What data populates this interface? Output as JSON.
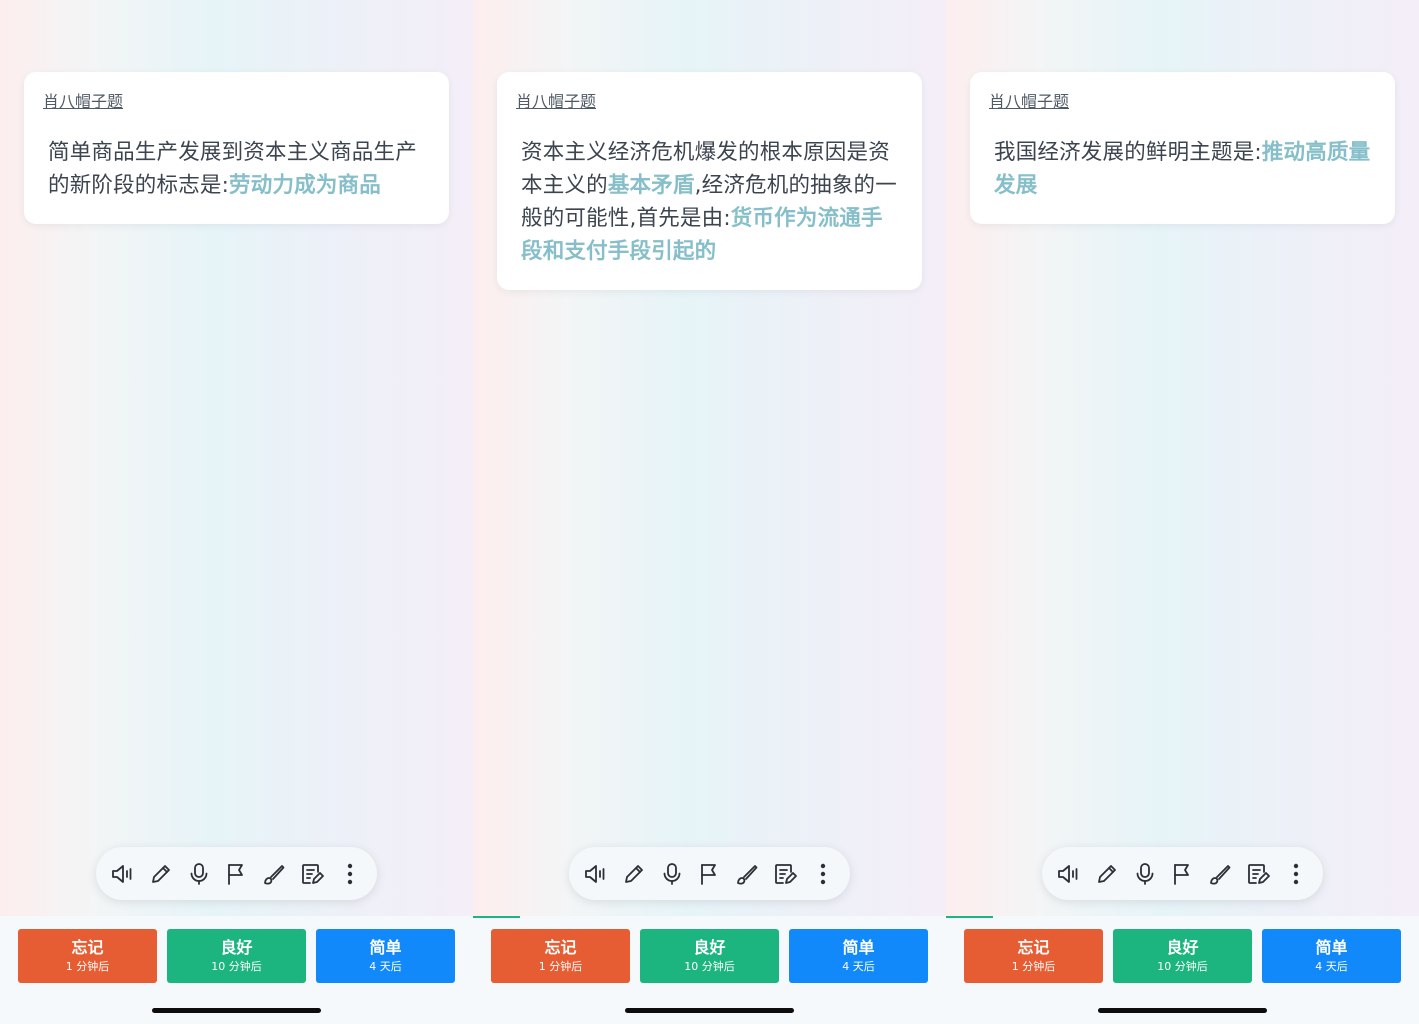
{
  "screens": [
    {
      "tag": "肖八帽子题",
      "question": {
        "prefix": "简单商品生产发展到资本主义商品生产的新阶段的标志是:",
        "answer1": "劳动力成为商品",
        "mid": "",
        "answer2": "",
        "suffix": ""
      }
    },
    {
      "tag": "肖八帽子题",
      "question": {
        "prefix": "资本主义经济危机爆发的根本原因是资本主义的",
        "answer1": "基本矛盾",
        "mid": ",经济危机的抽象的一般的可能性,首先是由:",
        "answer2": "货币作为流通手段和支付手段引起的",
        "suffix": ""
      }
    },
    {
      "tag": "肖八帽子题",
      "question": {
        "prefix": "我国经济发展的鲜明主题是:",
        "answer1": "推动高质量发展",
        "mid": "",
        "answer2": "",
        "suffix": ""
      }
    }
  ],
  "progress_fraction": [
    0,
    0.1,
    0.1
  ],
  "toolbar": {
    "icons": [
      "speaker-icon",
      "pencil-icon",
      "microphone-icon",
      "flag-icon",
      "brush-icon",
      "note-edit-icon",
      "more-vertical-icon"
    ]
  },
  "buttons": {
    "forget": {
      "label": "忘记",
      "sub": "1 分钟后"
    },
    "good": {
      "label": "良好",
      "sub": "10 分钟后"
    },
    "easy": {
      "label": "简单",
      "sub": "4 天后"
    }
  },
  "colors": {
    "answer": "#86bfca",
    "forget": "#e65c33",
    "good": "#1db57f",
    "easy": "#1189fb"
  }
}
